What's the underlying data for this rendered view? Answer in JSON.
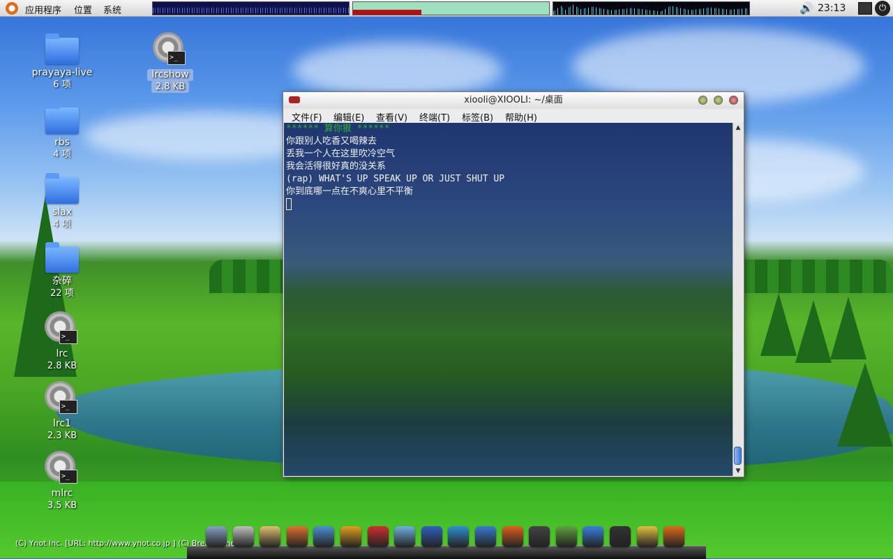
{
  "top_panel": {
    "menu": [
      "应用程序",
      "位置",
      "系统"
    ],
    "clock": "23:13",
    "icons": [
      "ubuntu-logo-icon",
      "cpu-monitor",
      "memory-monitor",
      "network-monitor",
      "volume-icon",
      "network-icon",
      "power-icon"
    ],
    "memory_usage_fraction": 0.35
  },
  "desktop": {
    "icons": [
      {
        "label": "prayaya-live",
        "sub": "6 项",
        "type": "folder"
      },
      {
        "label": "rbs",
        "sub": "4 项",
        "type": "folder"
      },
      {
        "label": "slax",
        "sub": "4 项",
        "type": "folder"
      },
      {
        "label": "杂碎",
        "sub": "22 项",
        "type": "folder"
      },
      {
        "label": "lrc",
        "sub": "2.8 KB",
        "type": "executable"
      },
      {
        "label": "lrc1",
        "sub": "2.3 KB",
        "type": "executable"
      },
      {
        "label": "mlrc",
        "sub": "3.5 KB",
        "type": "executable"
      },
      {
        "label": "lrcshow",
        "sub": "2.8 KB",
        "type": "executable",
        "selected": true
      }
    ]
  },
  "terminal": {
    "title": "xiooli@XIOOLI: ~/桌面",
    "menu": [
      "文件(F)",
      "编辑(E)",
      "查看(V)",
      "终端(T)",
      "标签(B)",
      "帮助(H)"
    ],
    "lines": [
      "****** 算你狠 ******",
      "你跟别人吃香又喝辣去",
      "丢我一个人在这里吹冷空气",
      "我会活得很好真的没关系",
      "(rap) WHAT'S UP SPEAK UP OR JUST SHUT UP",
      "你到底哪一点在不爽心里不平衡"
    ],
    "scrollbar_up": "▲",
    "scrollbar_down": "▼"
  },
  "bottom": {
    "copyright": "(C) Ynot Inc. [URL: http://www.ynot.co.jp ]  (C) Break Time HA",
    "dock_icons": [
      "computer-icon",
      "film-icon",
      "media-icon",
      "fox-icon",
      "fish-icon",
      "swirl-icon",
      "pdf-icon",
      "wave-icon",
      "arrow-icon",
      "globe-icon",
      "monitor-icon",
      "firefox-icon",
      "terminal-icon",
      "editor-icon",
      "folder-icon",
      "terminal-icon-2",
      "chat-icon",
      "ubuntu-icon"
    ],
    "colors": [
      "#8aa0c0",
      "#c0c0c0",
      "#e0c070",
      "#e07030",
      "#4a90d0",
      "#e0a020",
      "#d03030",
      "#70b0e0",
      "#3060c0",
      "#3090d0",
      "#3a7ad0",
      "#e06020",
      "#444444",
      "#60a040",
      "#3a7ee0",
      "#333333",
      "#e0c040",
      "#e06a1a"
    ]
  }
}
